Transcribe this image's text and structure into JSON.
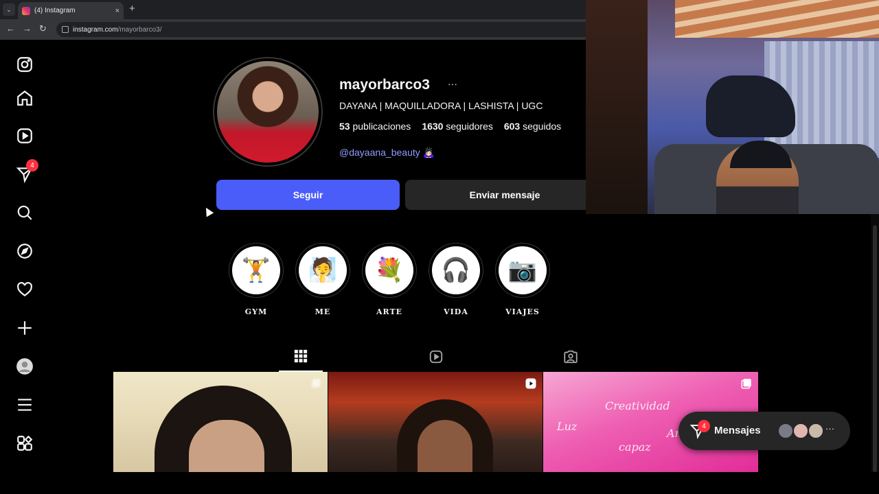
{
  "browser": {
    "tab_title": "(4) Instagram",
    "tab_close": "×",
    "tab_menu": "⌄",
    "new_tab": "+",
    "url_host": "instagram.com",
    "url_path": "/mayorbarco3/"
  },
  "sidebar": {
    "notification_count": "4"
  },
  "profile": {
    "username": "mayorbarco3",
    "more": "···",
    "bio_name": "DAYANA | MAQUILLADORA | LASHISTA | UGC",
    "stats": {
      "posts_count": "53",
      "posts_label": "publicaciones",
      "followers_count": "1630",
      "followers_label": "seguidores",
      "following_count": "603",
      "following_label": "seguidos"
    },
    "link": "@dayaana_beauty 🙇🏻‍♀️",
    "follow_button": "Seguir",
    "message_button": "Enviar mensaje"
  },
  "highlights": [
    {
      "label": "GYM",
      "emoji": "🏋"
    },
    {
      "label": "ME",
      "emoji": "🧖"
    },
    {
      "label": "ARTE",
      "emoji": "💐"
    },
    {
      "label": "VIDA",
      "emoji": "🎧"
    },
    {
      "label": "VIAJES",
      "emoji": "📷"
    }
  ],
  "post3_words": [
    "Creatividad",
    "Amor",
    "Luz",
    "capaz"
  ],
  "messages": {
    "label": "Mensajes",
    "badge": "4",
    "more": "···"
  },
  "colors": {
    "follow_button": "#4a5df9",
    "link": "#8f9dff",
    "badge": "#ff3040"
  }
}
